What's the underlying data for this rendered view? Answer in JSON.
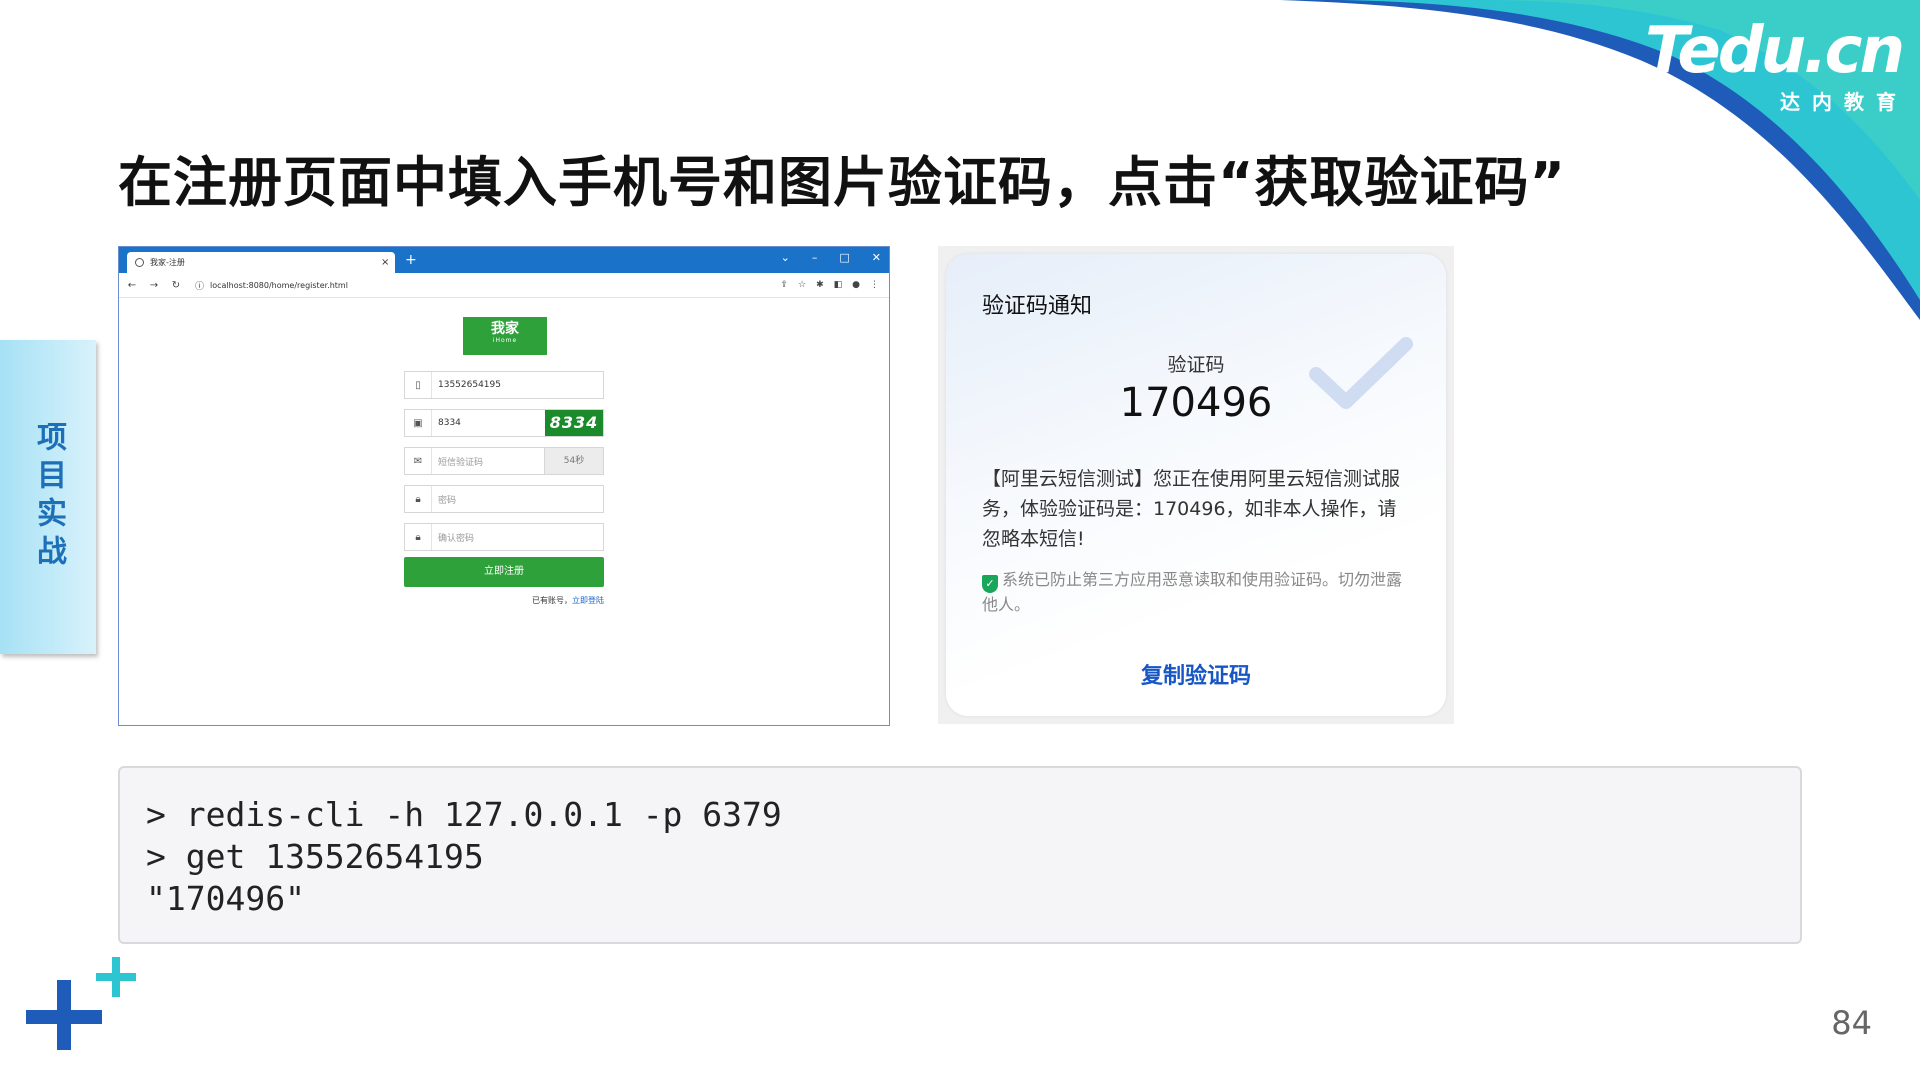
{
  "brand": {
    "logo_main": "Tedu.cn",
    "logo_sub": "达内教育"
  },
  "slide": {
    "title": "在注册页面中填入手机号和图片验证码，点击“获取验证码”",
    "side_tab": "项目实战",
    "page_number": "84"
  },
  "browser": {
    "tab_title": "我家-注册",
    "tab_close": "×",
    "new_tab": "+",
    "url": "localhost:8080/home/register.html",
    "reg_logo_cn": "我家",
    "reg_logo_en": "iHome",
    "phone_value": "13552654195",
    "captcha_input_value": "8334",
    "captcha_image_text": "8334",
    "sms_placeholder": "短信验证码",
    "sms_countdown": "54秒",
    "password_placeholder": "密码",
    "confirm_password_placeholder": "确认密码",
    "submit_label": "立即注册",
    "login_hint": "已有账号，",
    "login_link": "立即登陆"
  },
  "sms": {
    "title": "验证码通知",
    "code_label": "验证码",
    "code": "170496",
    "body": "【阿里云短信测试】您正在使用阿里云短信测试服务，体验验证码是：170496，如非本人操作，请忽略本短信!",
    "note": "系统已防止第三方应用恶意读取和使用验证码。切勿泄露他人。",
    "copy_button": "复制验证码"
  },
  "terminal": {
    "lines": [
      "> redis-cli -h 127.0.0.1 -p 6379",
      "> get 13552654195",
      "\"170496\""
    ]
  },
  "colors": {
    "accent_blue": "#1756c4",
    "brand_teal": "#2ec5d3",
    "ihome_green": "#2ea13a",
    "browser_blue": "#1a73c8"
  }
}
